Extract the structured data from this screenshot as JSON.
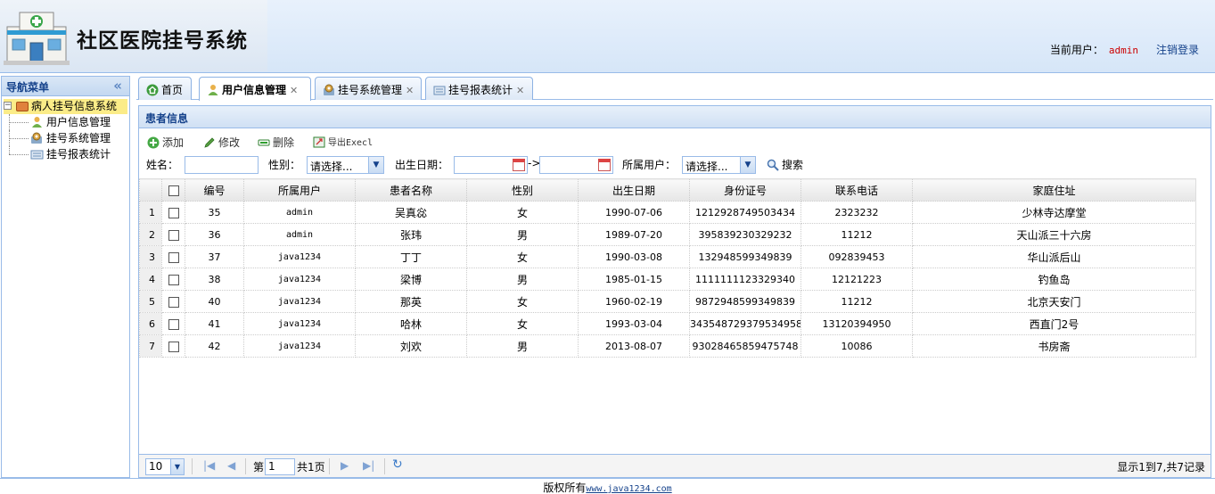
{
  "header": {
    "title": "社区医院挂号系统",
    "current_user_label": "当前用户：",
    "current_user": "admin",
    "logout": "注销登录"
  },
  "nav": {
    "title": "导航菜单",
    "collapse_icon": "double-chevron-left-icon",
    "root": "病人挂号信息系统",
    "items": [
      {
        "label": "用户信息管理",
        "icon": "user-icon"
      },
      {
        "label": "挂号系统管理",
        "icon": "gear-icon"
      },
      {
        "label": "挂号报表统计",
        "icon": "report-icon"
      }
    ]
  },
  "tabs": [
    {
      "label": "首页",
      "closable": false
    },
    {
      "label": "用户信息管理",
      "closable": true,
      "active": true
    },
    {
      "label": "挂号系统管理",
      "closable": true
    },
    {
      "label": "挂号报表统计",
      "closable": true
    }
  ],
  "panel": {
    "title": "患者信息",
    "toolbar": {
      "add": "添加",
      "edit": "修改",
      "delete": "删除",
      "export": "导出Execl"
    },
    "search": {
      "name_label": "姓名：",
      "gender_label": "性别：",
      "gender_value": "请选择...",
      "birth_label": "出生日期：",
      "range_sep": "->",
      "owner_label": "所属用户：",
      "owner_value": "请选择...",
      "search_btn": "搜索"
    },
    "columns": [
      "编号",
      "所属用户",
      "患者名称",
      "性别",
      "出生日期",
      "身份证号",
      "联系电话",
      "家庭住址"
    ],
    "rows": [
      {
        "n": "1",
        "id": "35",
        "owner": "admin",
        "name": "吴真惢",
        "gender": "女",
        "birth": "1990-07-06",
        "idcard": "1212928749503434",
        "phone": "2323232",
        "addr": "少林寺达摩堂"
      },
      {
        "n": "2",
        "id": "36",
        "owner": "admin",
        "name": "张玮",
        "gender": "男",
        "birth": "1989-07-20",
        "idcard": "395839230329232",
        "phone": "11212",
        "addr": "天山派三十六房"
      },
      {
        "n": "3",
        "id": "37",
        "owner": "java1234",
        "name": "丁丁",
        "gender": "女",
        "birth": "1990-03-08",
        "idcard": "132948599349839",
        "phone": "092839453",
        "addr": "华山派后山"
      },
      {
        "n": "4",
        "id": "38",
        "owner": "java1234",
        "name": "梁博",
        "gender": "男",
        "birth": "1985-01-15",
        "idcard": "1111111123329340",
        "phone": "12121223",
        "addr": "钓鱼岛"
      },
      {
        "n": "5",
        "id": "40",
        "owner": "java1234",
        "name": "那英",
        "gender": "女",
        "birth": "1960-02-19",
        "idcard": "9872948599349839",
        "phone": "11212",
        "addr": "北京天安门"
      },
      {
        "n": "6",
        "id": "41",
        "owner": "java1234",
        "name": "哈林",
        "gender": "女",
        "birth": "1993-03-04",
        "idcard": "343548729379534958",
        "phone": "13120394950",
        "addr": "西直门2号"
      },
      {
        "n": "7",
        "id": "42",
        "owner": "java1234",
        "name": "刘欢",
        "gender": "男",
        "birth": "2013-08-07",
        "idcard": "93028465859475748",
        "phone": "10086",
        "addr": "书房斋"
      }
    ]
  },
  "pager": {
    "page_size": "10",
    "page_label": "第",
    "page_value": "1",
    "total_pages": "共1页",
    "summary": "显示1到7,共7记录"
  },
  "footer": {
    "text": "版权所有",
    "link": "www.java1234.com"
  }
}
